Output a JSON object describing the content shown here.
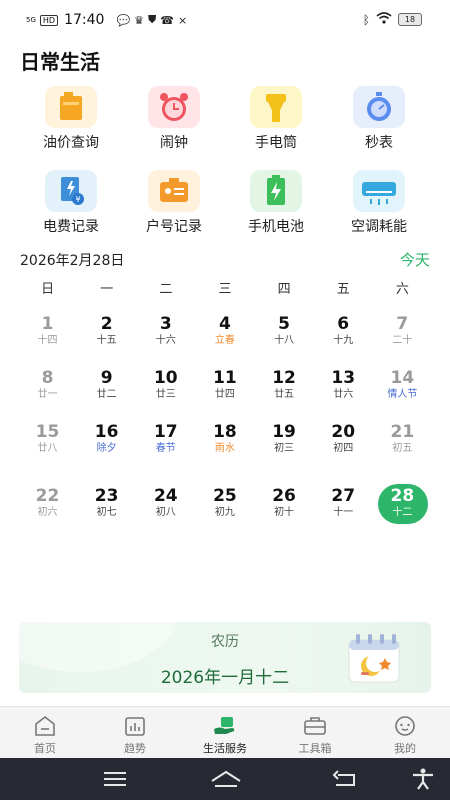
{
  "status_bar": {
    "network": "5G",
    "hd": "HD",
    "time": "17:40",
    "battery": "18"
  },
  "page": {
    "title": "日常生活"
  },
  "tools": [
    {
      "label": "油价查询",
      "icon": "fuel-icon"
    },
    {
      "label": "闹钟",
      "icon": "alarm-clock-icon"
    },
    {
      "label": "手电筒",
      "icon": "flashlight-icon"
    },
    {
      "label": "秒表",
      "icon": "stopwatch-icon"
    },
    {
      "label": "电费记录",
      "icon": "electricity-bill-icon"
    },
    {
      "label": "户号记录",
      "icon": "account-card-icon"
    },
    {
      "label": "手机电池",
      "icon": "phone-battery-icon"
    },
    {
      "label": "空调耗能",
      "icon": "air-conditioner-icon"
    }
  ],
  "calendar": {
    "header": "2026年2月28日",
    "today_label": "今天",
    "weekdays": [
      "日",
      "一",
      "二",
      "三",
      "四",
      "五",
      "六"
    ],
    "selected_day": "28",
    "weeks": [
      [
        {
          "d": "1",
          "l": "十四",
          "t": "we"
        },
        {
          "d": "2",
          "l": "十五"
        },
        {
          "d": "3",
          "l": "十六"
        },
        {
          "d": "4",
          "l": "立春",
          "t": "term"
        },
        {
          "d": "5",
          "l": "十八"
        },
        {
          "d": "6",
          "l": "十九"
        },
        {
          "d": "7",
          "l": "二十",
          "t": "we"
        }
      ],
      [
        {
          "d": "8",
          "l": "廿一",
          "t": "we"
        },
        {
          "d": "9",
          "l": "廿二"
        },
        {
          "d": "10",
          "l": "廿三"
        },
        {
          "d": "11",
          "l": "廿四"
        },
        {
          "d": "12",
          "l": "廿五"
        },
        {
          "d": "13",
          "l": "廿六"
        },
        {
          "d": "14",
          "l": "情人节",
          "t": "we-fest"
        }
      ],
      [
        {
          "d": "15",
          "l": "廿八",
          "t": "we"
        },
        {
          "d": "16",
          "l": "除夕",
          "t": "fest"
        },
        {
          "d": "17",
          "l": "春节",
          "t": "fest"
        },
        {
          "d": "18",
          "l": "雨水",
          "t": "term"
        },
        {
          "d": "19",
          "l": "初三"
        },
        {
          "d": "20",
          "l": "初四"
        },
        {
          "d": "21",
          "l": "初五",
          "t": "we"
        }
      ],
      [
        {
          "d": "22",
          "l": "初六",
          "t": "we"
        },
        {
          "d": "23",
          "l": "初七"
        },
        {
          "d": "24",
          "l": "初八"
        },
        {
          "d": "25",
          "l": "初九"
        },
        {
          "d": "26",
          "l": "初十"
        },
        {
          "d": "27",
          "l": "十一"
        },
        {
          "d": "28",
          "l": "十二",
          "t": "sel"
        }
      ]
    ]
  },
  "lunar_card": {
    "title": "农历",
    "date": "2026年一月十二"
  },
  "tabs": [
    {
      "label": "首页",
      "icon": "home-icon"
    },
    {
      "label": "趋势",
      "icon": "chart-icon"
    },
    {
      "label": "生活服务",
      "icon": "life-service-icon",
      "active": true
    },
    {
      "label": "工具箱",
      "icon": "toolbox-icon"
    },
    {
      "label": "我的",
      "icon": "profile-icon"
    }
  ],
  "colors": {
    "accent": "#2db56a",
    "solar_term": "#f08a2e",
    "festival": "#4a6fd6"
  }
}
